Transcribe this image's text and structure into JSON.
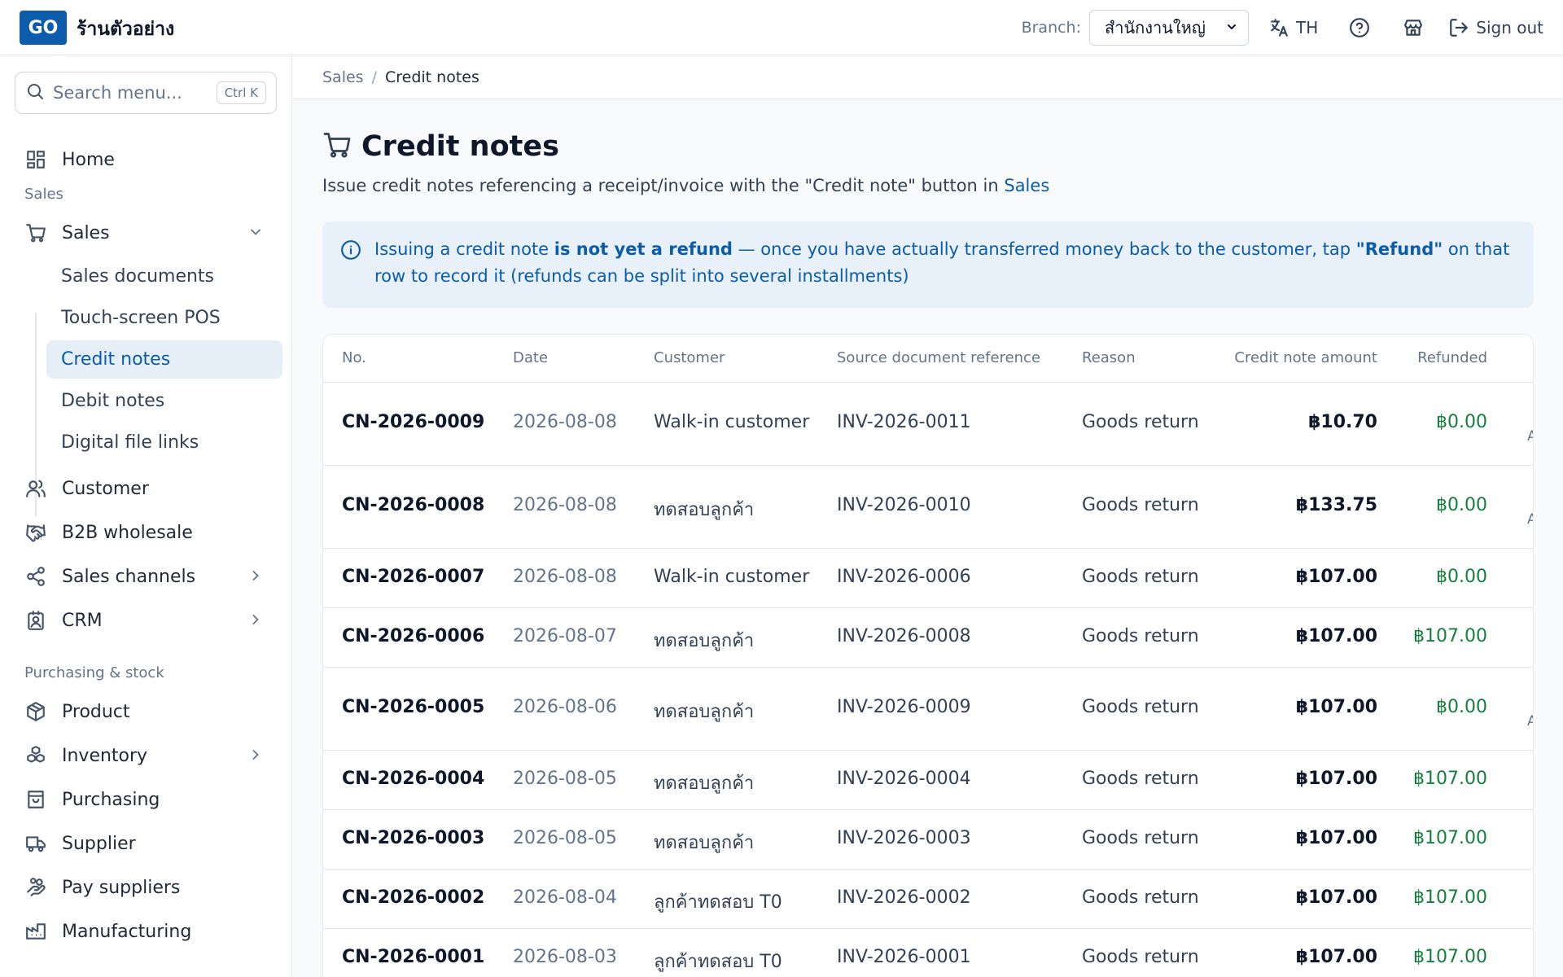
{
  "topbar": {
    "logo_text": "GO",
    "shop_name": "ร้านตัวอย่าง",
    "branch_label": "Branch:",
    "branch_value": "สำนักงานใหญ่",
    "language": "TH",
    "signout_label": "Sign out"
  },
  "sidebar": {
    "search_placeholder": "Search menu...",
    "search_shortcut": "Ctrl K",
    "home": "Home",
    "section_sales": "Sales",
    "sales": "Sales",
    "sub_items": [
      "Sales documents",
      "Touch-screen POS",
      "Credit notes",
      "Debit notes",
      "Digital file links"
    ],
    "customer": "Customer",
    "b2b": "B2B wholesale",
    "sales_channels": "Sales channels",
    "crm": "CRM",
    "section_purchasing": "Purchasing & stock",
    "product": "Product",
    "inventory": "Inventory",
    "purchasing": "Purchasing",
    "supplier": "Supplier",
    "pay_suppliers": "Pay suppliers",
    "manufacturing": "Manufacturing"
  },
  "breadcrumb": {
    "parent": "Sales",
    "separator": "/",
    "current": "Credit notes"
  },
  "page": {
    "title": "Credit notes",
    "subtitle_text": "Issue credit notes referencing a receipt/invoice with the \"Credit note\" button in ",
    "subtitle_link": "Sales"
  },
  "info": {
    "part1": "Issuing a credit note ",
    "bold1": "is not yet a refund",
    "part2": " — once you have actually transferred money back to the customer, tap ",
    "bold2": "\"Refund\"",
    "part3": " on that row to record it (refunds can be split into several installments)"
  },
  "table": {
    "headers": [
      "No.",
      "Date",
      "Customer",
      "Source document reference",
      "Reason",
      "Credit note amount",
      "Refunded"
    ],
    "rows": [
      {
        "no": "CN-2026-0009",
        "date": "2026-08-08",
        "customer": "Walk-in customer",
        "source": "INV-2026-0011",
        "reason": "Goods return",
        "amount": "฿10.70",
        "refunded": "฿0.00",
        "extra": "A"
      },
      {
        "no": "CN-2026-0008",
        "date": "2026-08-08",
        "customer": "ทดสอบลูกค้า",
        "source": "INV-2026-0010",
        "reason": "Goods return",
        "amount": "฿133.75",
        "refunded": "฿0.00",
        "extra": "A"
      },
      {
        "no": "CN-2026-0007",
        "date": "2026-08-08",
        "customer": "Walk-in customer",
        "source": "INV-2026-0006",
        "reason": "Goods return",
        "amount": "฿107.00",
        "refunded": "฿0.00",
        "extra": ""
      },
      {
        "no": "CN-2026-0006",
        "date": "2026-08-07",
        "customer": "ทดสอบลูกค้า",
        "source": "INV-2026-0008",
        "reason": "Goods return",
        "amount": "฿107.00",
        "refunded": "฿107.00",
        "extra": ""
      },
      {
        "no": "CN-2026-0005",
        "date": "2026-08-06",
        "customer": "ทดสอบลูกค้า",
        "source": "INV-2026-0009",
        "reason": "Goods return",
        "amount": "฿107.00",
        "refunded": "฿0.00",
        "extra": "A"
      },
      {
        "no": "CN-2026-0004",
        "date": "2026-08-05",
        "customer": "ทดสอบลูกค้า",
        "source": "INV-2026-0004",
        "reason": "Goods return",
        "amount": "฿107.00",
        "refunded": "฿107.00",
        "extra": ""
      },
      {
        "no": "CN-2026-0003",
        "date": "2026-08-05",
        "customer": "ทดสอบลูกค้า",
        "source": "INV-2026-0003",
        "reason": "Goods return",
        "amount": "฿107.00",
        "refunded": "฿107.00",
        "extra": ""
      },
      {
        "no": "CN-2026-0002",
        "date": "2026-08-04",
        "customer": "ลูกค้าทดสอบ T0",
        "source": "INV-2026-0002",
        "reason": "Goods return",
        "amount": "฿107.00",
        "refunded": "฿107.00",
        "extra": ""
      },
      {
        "no": "CN-2026-0001",
        "date": "2026-08-03",
        "customer": "ลูกค้าทดสอบ T0",
        "source": "INV-2026-0001",
        "reason": "Goods return",
        "amount": "฿107.00",
        "refunded": "฿107.00",
        "extra": ""
      }
    ]
  },
  "colors": {
    "brand": "#0b5cab",
    "refund_green": "#15803d",
    "active_bg": "#e6eef7",
    "info_bg": "#e8f0f9"
  },
  "icons": [
    "translate-icon",
    "help-icon",
    "store-icon",
    "sign-out-icon",
    "search-icon",
    "home-grid-icon",
    "cart-icon",
    "users-icon",
    "handshake-icon",
    "share-icon",
    "contact-icon",
    "package-icon",
    "boxes-icon",
    "shopping-bag-icon",
    "truck-icon",
    "hand-coins-icon",
    "factory-icon",
    "info-icon",
    "chevron-down-icon",
    "chevron-right-icon"
  ]
}
